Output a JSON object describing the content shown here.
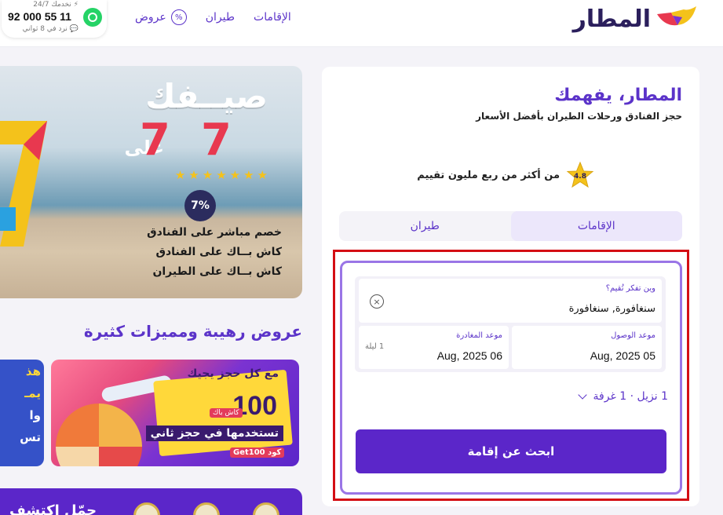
{
  "header": {
    "logo_text": "المطار",
    "nav": [
      {
        "label": "الإقامات"
      },
      {
        "label": "طيران"
      },
      {
        "label": "عروض"
      }
    ],
    "contact": {
      "availability": "⚡ نخدمك 24/7",
      "phone": "92 000 55 11",
      "response": "💬 نرد في 8 ثواني"
    }
  },
  "card": {
    "title": "المطار، يفهمك",
    "subtitle": "حجز الفنادق ورحلات الطيران بأفضل الأسعار",
    "rating_value": "4.8",
    "rating_text": "من أكثر من ربع مليون تقييم",
    "tabs": [
      {
        "label": "الإقامات",
        "active": true
      },
      {
        "label": "طيران",
        "active": false
      }
    ],
    "destination": {
      "label": "وين تفكر تُقيم؟",
      "value": "سنغافورة, سنغافورة"
    },
    "checkin": {
      "label": "موعد الوصول",
      "value": "05 Aug, 2025"
    },
    "checkout": {
      "label": "موعد المغادرة",
      "value": "06 Aug, 2025",
      "nights": "1 ليلة"
    },
    "guests": "1 نزيل · 1 غرفة",
    "search_button": "ابحث عن إقامة"
  },
  "banner": {
    "line1": "صيــفك",
    "seven": "7",
    "ala": "على",
    "stars": [
      "★",
      "★",
      "★",
      "★",
      "★",
      "★",
      "★"
    ],
    "pct": "7%",
    "offers": [
      "خصم مباشر على الفنادق",
      "كاش بــاك على الفنادق",
      "كاش بــاك على الطيران"
    ]
  },
  "section_title": "عروض رهيبة ومميزات كثيرة",
  "promo1": {
    "line1": "مع كل حجز يجيك",
    "amount": "100",
    "cashback": "كاش باك",
    "line2": "تستخدمها في حجز ثاني",
    "code": "Get100 كود"
  },
  "promo2": {
    "lines": [
      "هذ",
      "يمـ",
      "وا",
      "تس"
    ]
  },
  "bottom_bar": {
    "text": "حمّل اكتشف"
  },
  "colors": {
    "brand": "#5b33c9",
    "button": "#5b26c9",
    "highlight": "#d40e14"
  }
}
